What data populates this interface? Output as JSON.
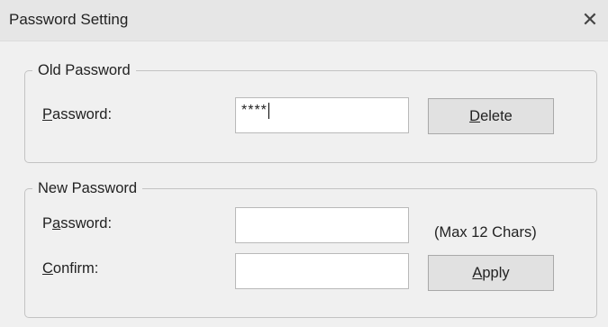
{
  "window": {
    "title": "Password Setting",
    "close_icon": "close-icon"
  },
  "old_password": {
    "group_label": "Old Password",
    "password_label_accel": "P",
    "password_label_rest": "assword:",
    "password_value": "****",
    "delete_accel": "D",
    "delete_rest": "elete"
  },
  "new_password": {
    "group_label": "New Password",
    "password_label_pre": "P",
    "password_label_accel": "a",
    "password_label_rest": "ssword:",
    "password_value": "",
    "max_note": "(Max 12 Chars)",
    "confirm_label_accel": "C",
    "confirm_label_rest": "onfirm:",
    "confirm_value": "",
    "apply_accel": "A",
    "apply_rest": "pply"
  }
}
